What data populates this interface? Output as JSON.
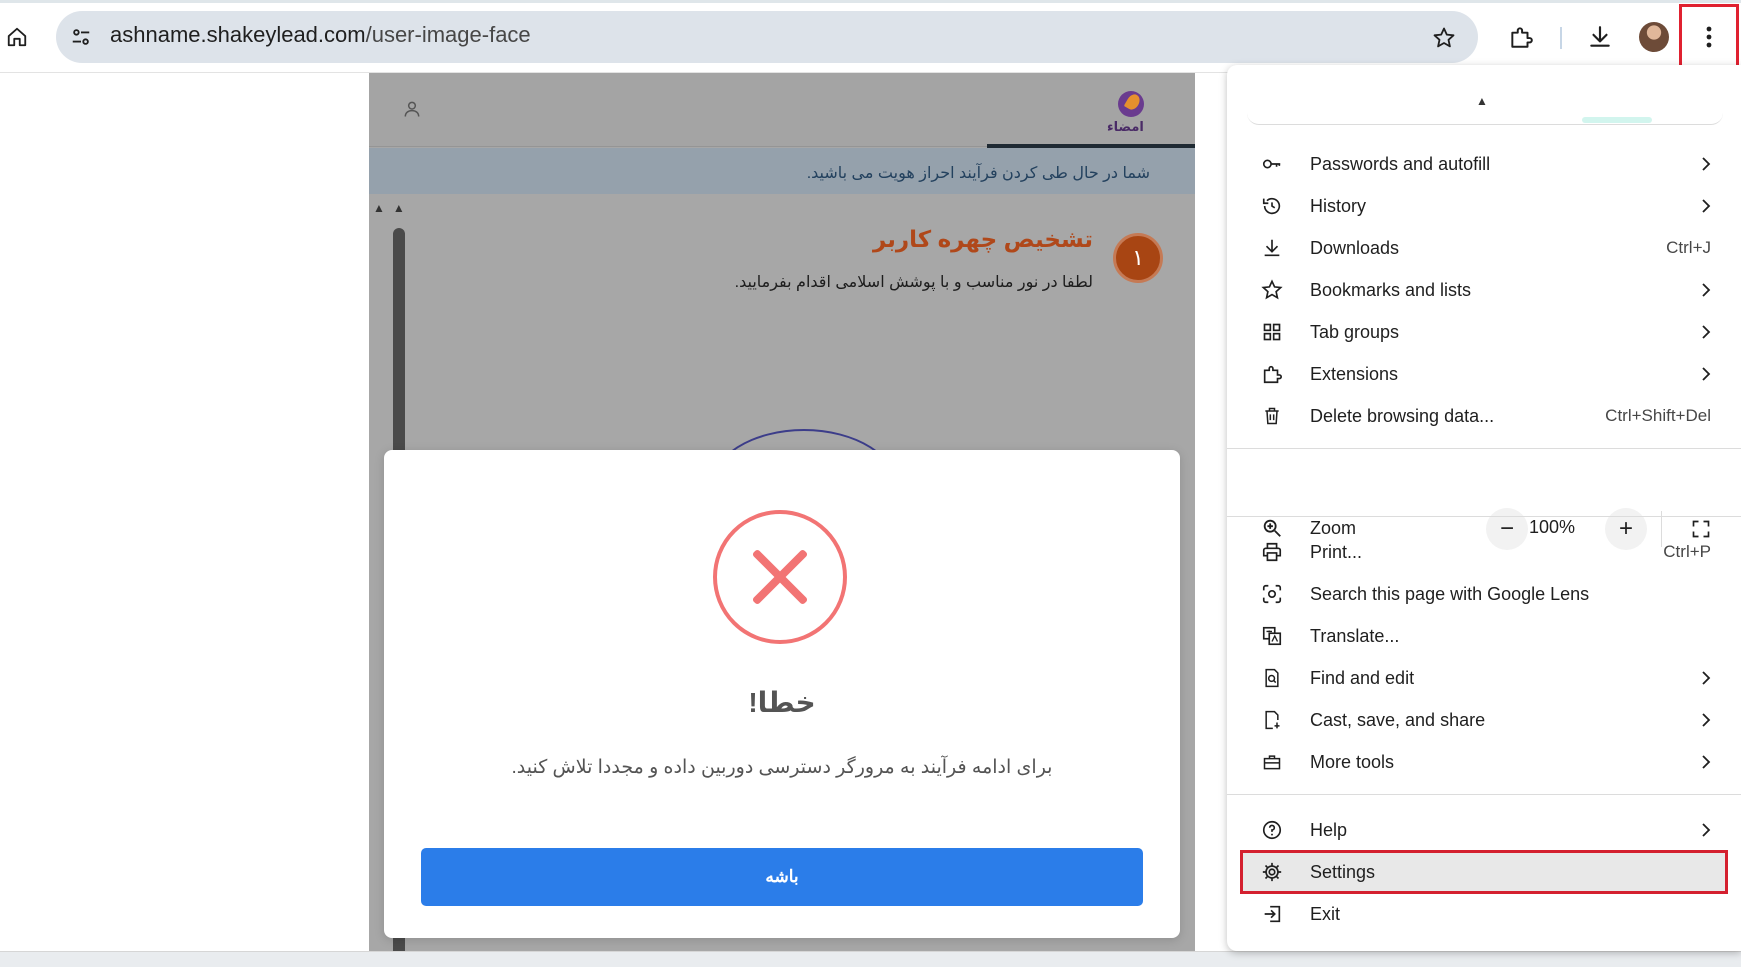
{
  "browser": {
    "url_host": "ashname.shakeylead.com",
    "url_path": "/user-image-face"
  },
  "page": {
    "logo_text": "امضاء",
    "notice": "شما در حال طی کردن فرآیند احراز هویت می باشید.",
    "step_number": "۱",
    "step_title": "تشخیص چهره کاربر",
    "step_description": "لطفا در نور مناسب و با پوشش اسلامی اقدام بفرمایید."
  },
  "dialog": {
    "title": "خطا!",
    "message": "برای ادامه فرآیند به مرورگر دسترسی دوربین داده و مجددا تلاش کنید.",
    "ok_label": "باشه"
  },
  "menu": {
    "items": [
      {
        "label": "Passwords and autofill",
        "icon": "key-icon",
        "submenu": true
      },
      {
        "label": "History",
        "icon": "history-icon",
        "submenu": true
      },
      {
        "label": "Downloads",
        "icon": "download-icon",
        "shortcut": "Ctrl+J"
      },
      {
        "label": "Bookmarks and lists",
        "icon": "star-icon",
        "submenu": true
      },
      {
        "label": "Tab groups",
        "icon": "tab-groups-icon",
        "submenu": true
      },
      {
        "label": "Extensions",
        "icon": "extensions-icon",
        "submenu": true
      },
      {
        "label": "Delete browsing data...",
        "icon": "trash-icon",
        "shortcut": "Ctrl+Shift+Del"
      },
      {
        "label": "Print...",
        "icon": "print-icon",
        "shortcut": "Ctrl+P"
      },
      {
        "label": "Search this page with Google Lens",
        "icon": "lens-icon"
      },
      {
        "label": "Translate...",
        "icon": "translate-icon"
      },
      {
        "label": "Find and edit",
        "icon": "find-icon",
        "submenu": true
      },
      {
        "label": "Cast, save, and share",
        "icon": "cast-icon",
        "submenu": true
      },
      {
        "label": "More tools",
        "icon": "toolbox-icon",
        "submenu": true
      },
      {
        "label": "Help",
        "icon": "help-icon",
        "submenu": true
      },
      {
        "label": "Settings",
        "icon": "gear-icon",
        "highlighted": true
      },
      {
        "label": "Exit",
        "icon": "exit-icon"
      }
    ],
    "zoom": {
      "label": "Zoom",
      "value": "100%",
      "minus": "−",
      "plus": "+"
    }
  },
  "colors": {
    "highlight_frame": "#d4202f",
    "primary_button": "#2b7de9",
    "error_icon": "#f27474"
  }
}
